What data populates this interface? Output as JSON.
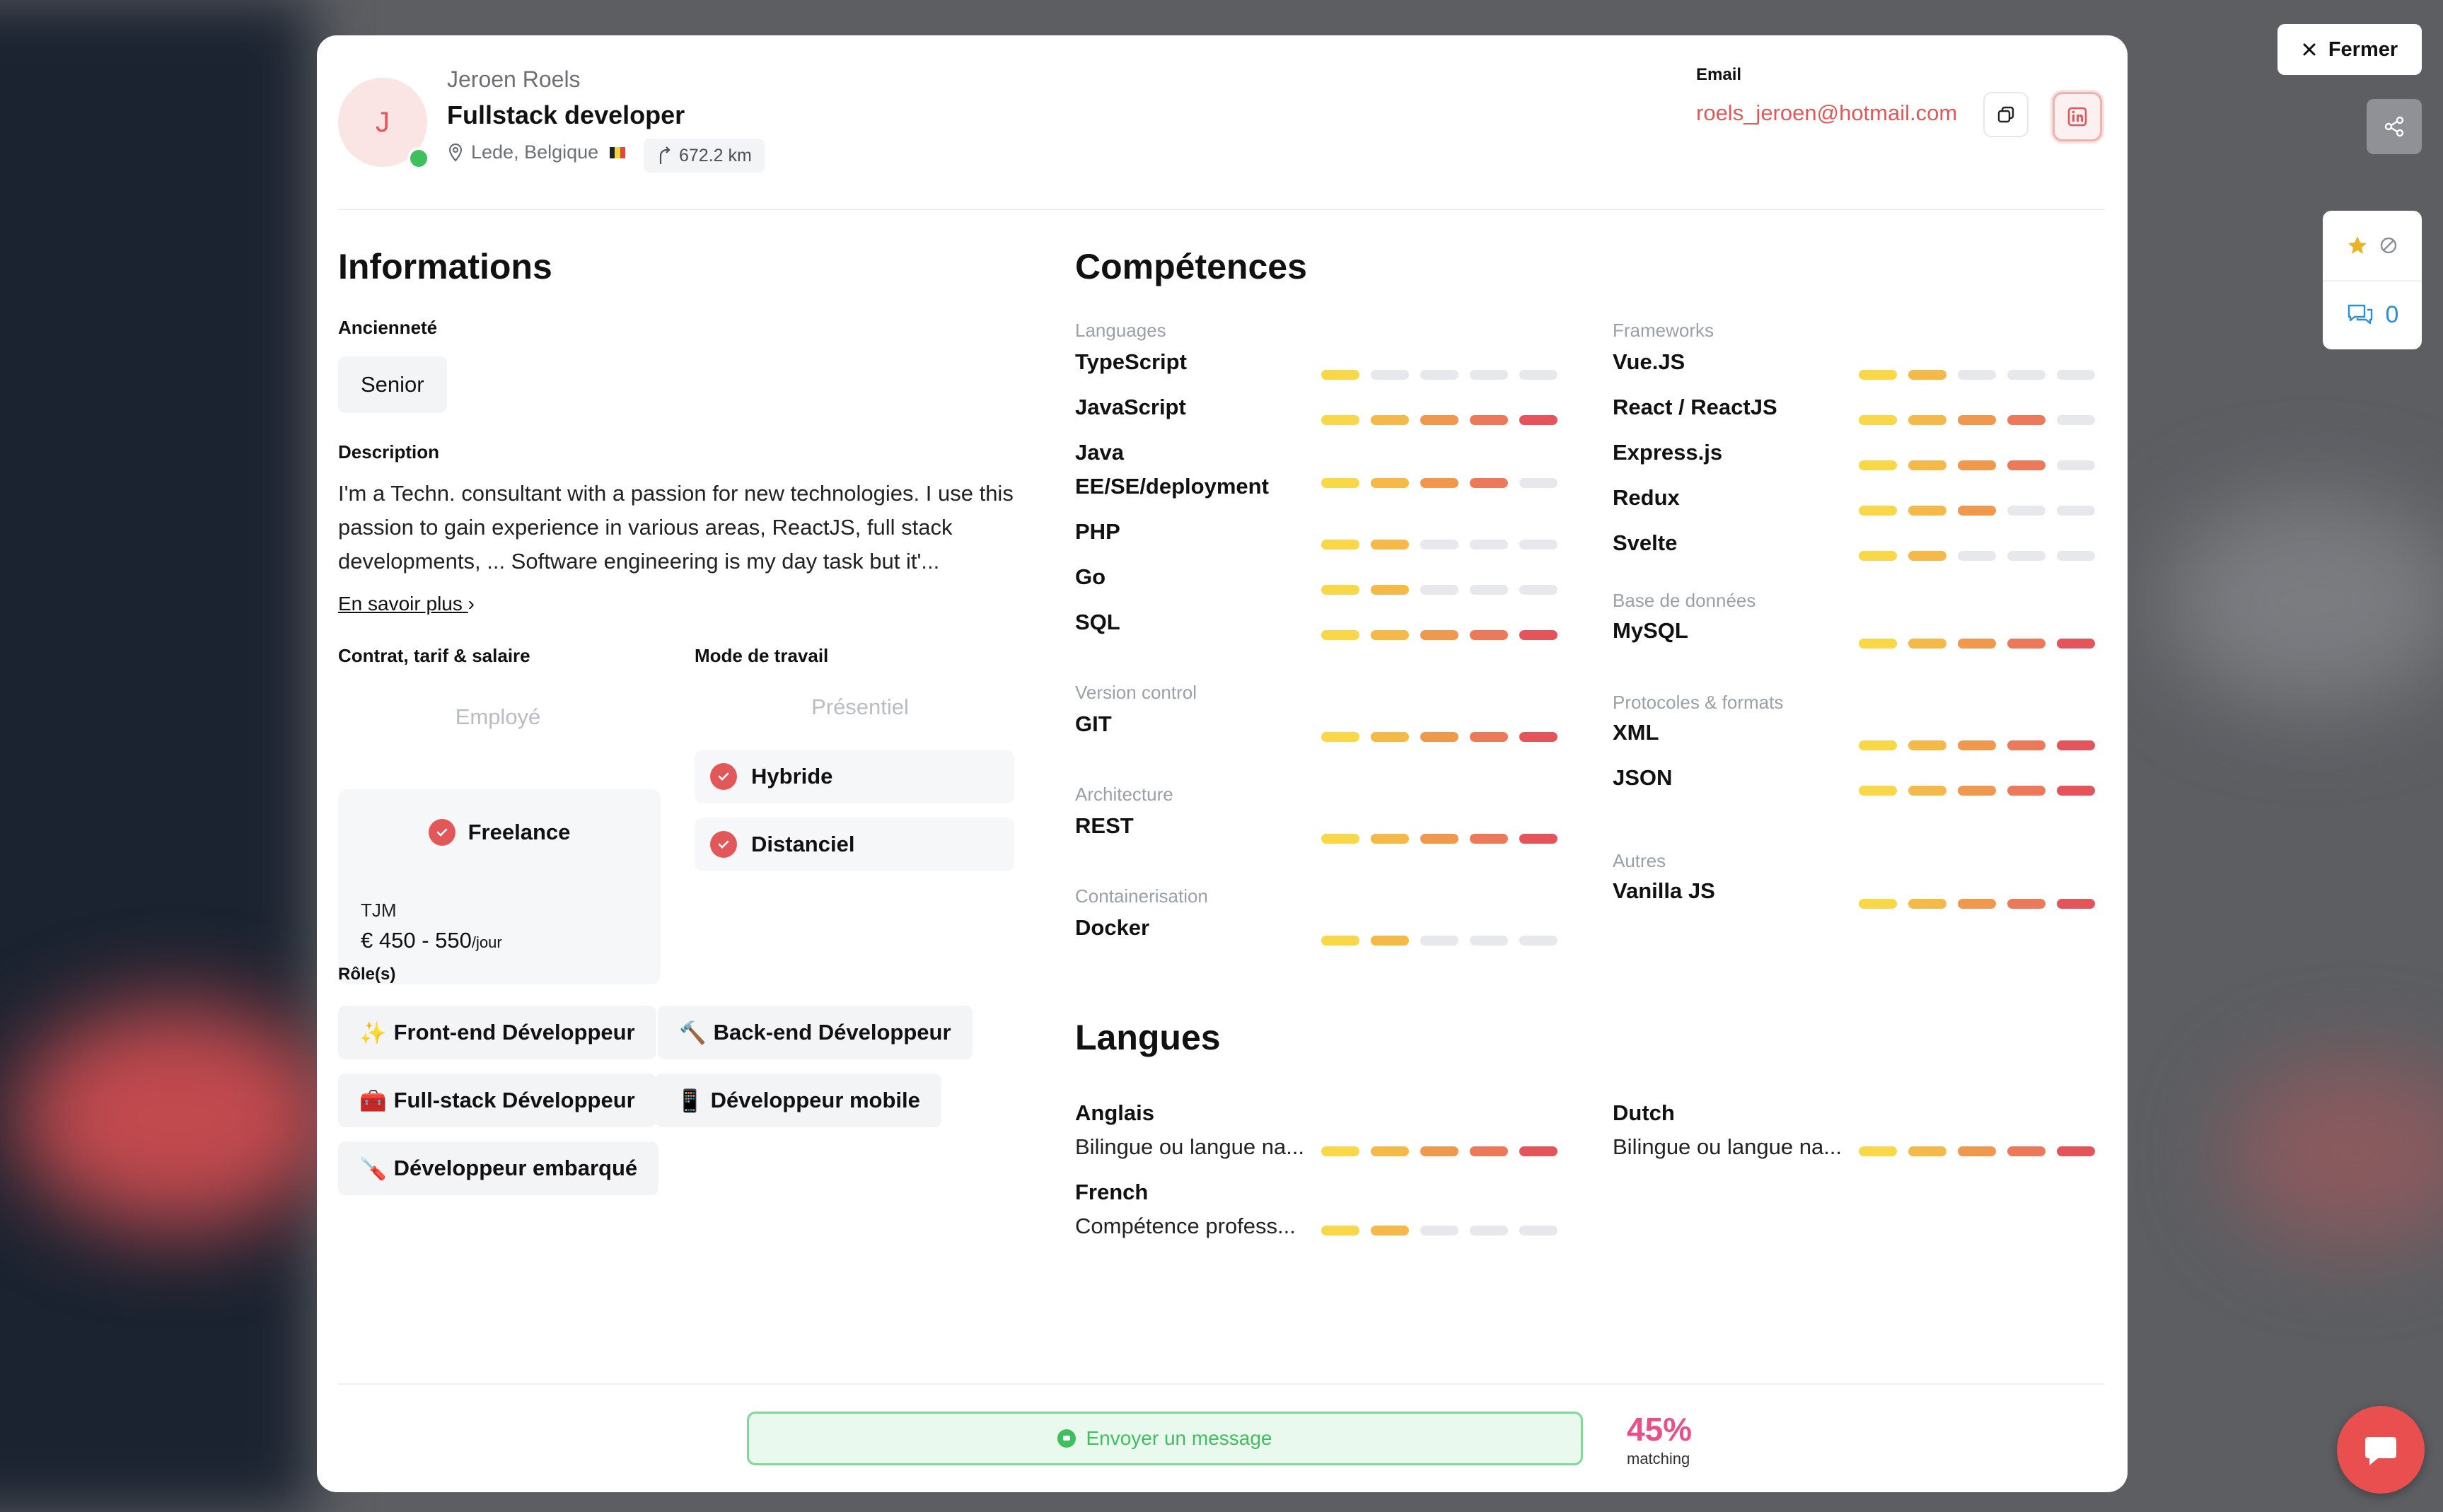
{
  "header": {
    "avatar_initial": "J",
    "name": "Jeroen Roels",
    "title": "Fullstack developer",
    "location": "Lede, Belgique",
    "distance": "672.2 km",
    "email_label": "Email",
    "email": "roels_jeroen@hotmail.com"
  },
  "informations": {
    "heading": "Informations",
    "seniority_label": "Ancienneté",
    "seniority": "Senior",
    "description_label": "Description",
    "description": "I'm a Techn. consultant with a passion for new technologies. I use this passion to gain experience in various areas, ReactJS, full stack developments, ... Software engineering is my day task but it'...",
    "more_link": "En savoir plus",
    "contract_label": "Contrat, tarif & salaire",
    "contract_employe": "Employé",
    "contract_freelance": "Freelance",
    "tjm_label": "TJM",
    "tjm_value": "€ 450 - 550",
    "tjm_unit": "/jour",
    "workmode_label": "Mode de travail",
    "workmode_presentiel": "Présentiel",
    "workmode_hybride": "Hybride",
    "workmode_distanciel": "Distanciel",
    "roles_label": "Rôle(s)",
    "roles": [
      {
        "emoji": "✨",
        "label": "Front-end Développeur"
      },
      {
        "emoji": "🔨",
        "label": "Back-end Développeur"
      },
      {
        "emoji": "🧰",
        "label": "Full-stack Développeur"
      },
      {
        "emoji": "📱",
        "label": "Développeur mobile"
      },
      {
        "emoji": "🪛",
        "label": "Développeur embarqué"
      }
    ]
  },
  "competences": {
    "heading": "Compétences",
    "left": [
      {
        "category": "Languages",
        "skills": [
          {
            "name": "TypeScript",
            "level": 1
          },
          {
            "name": "JavaScript",
            "level": 5
          },
          {
            "name": "Java EE/SE/deployment",
            "level": 4
          },
          {
            "name": "PHP",
            "level": 2
          },
          {
            "name": "Go",
            "level": 2
          },
          {
            "name": "SQL",
            "level": 5
          }
        ]
      },
      {
        "category": "Version control",
        "skills": [
          {
            "name": "GIT",
            "level": 5
          }
        ]
      },
      {
        "category": "Architecture",
        "skills": [
          {
            "name": "REST",
            "level": 5
          }
        ]
      },
      {
        "category": "Containerisation",
        "skills": [
          {
            "name": "Docker",
            "level": 2
          }
        ]
      }
    ],
    "right": [
      {
        "category": "Frameworks",
        "skills": [
          {
            "name": "Vue.JS",
            "level": 2
          },
          {
            "name": "React / ReactJS",
            "level": 4
          },
          {
            "name": "Express.js",
            "level": 4
          },
          {
            "name": "Redux",
            "level": 3
          },
          {
            "name": "Svelte",
            "level": 2
          }
        ]
      },
      {
        "category": "Base de données",
        "skills": [
          {
            "name": "MySQL",
            "level": 5
          }
        ]
      },
      {
        "category": "Protocoles & formats",
        "skills": [
          {
            "name": "XML",
            "level": 5
          },
          {
            "name": "JSON",
            "level": 5
          }
        ]
      },
      {
        "category": "Autres",
        "skills": [
          {
            "name": "Vanilla JS",
            "level": 5
          }
        ]
      }
    ],
    "level_colors": [
      "#f8d849",
      "#f5b94a",
      "#f0984e",
      "#ec7a5a",
      "#e5545b"
    ],
    "empty_color": "#e6e8ec"
  },
  "langues": {
    "heading": "Langues",
    "items": [
      {
        "name": "Anglais",
        "level_text": "Bilingue ou langue na...",
        "level": 5
      },
      {
        "name": "Dutch",
        "level_text": "Bilingue ou langue na...",
        "level": 5
      },
      {
        "name": "French",
        "level_text": "Compétence profess...",
        "level": 2
      }
    ]
  },
  "footer": {
    "cta": "Envoyer un message",
    "matching_pct": "45%",
    "matching_label": "matching"
  },
  "side": {
    "close_label": "Fermer",
    "comment_count": "0"
  }
}
